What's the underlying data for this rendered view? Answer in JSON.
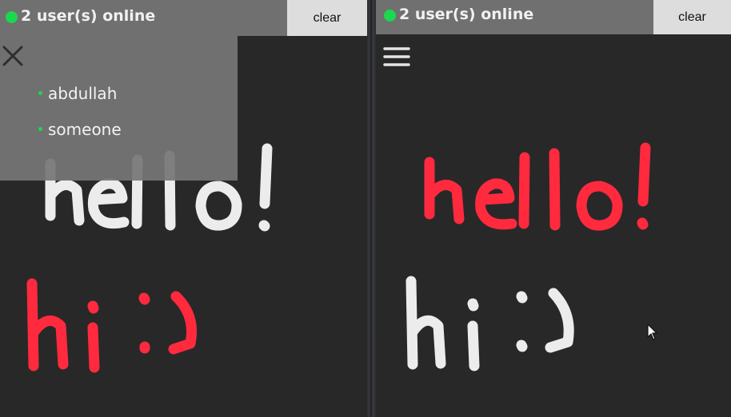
{
  "colors": {
    "online": "#1bd84f",
    "header_bg": "#707070",
    "canvas_bg": "#282828",
    "stroke_red": "#ff2a3e",
    "stroke_white": "#ececec"
  },
  "left_window": {
    "status": {
      "icon": "online-dot-icon",
      "text": "2 user(s) online"
    },
    "clear_label": "clear",
    "user_panel": {
      "close_icon": "close-icon",
      "users": [
        {
          "name": "abdullah"
        },
        {
          "name": "someone"
        }
      ]
    }
  },
  "right_window": {
    "status": {
      "icon": "online-dot-icon",
      "text": "2 user(s) online"
    },
    "clear_label": "clear",
    "menu_icon": "hamburger-menu-icon",
    "cursor_icon": "mouse-pointer-icon"
  },
  "drawings": [
    {
      "name": "hello-drawing",
      "left_color": "#ececec",
      "right_color": "#ff2a3e"
    },
    {
      "name": "hi-smiley-drawing",
      "left_color": "#ff2a3e",
      "right_color": "#ececec"
    }
  ]
}
